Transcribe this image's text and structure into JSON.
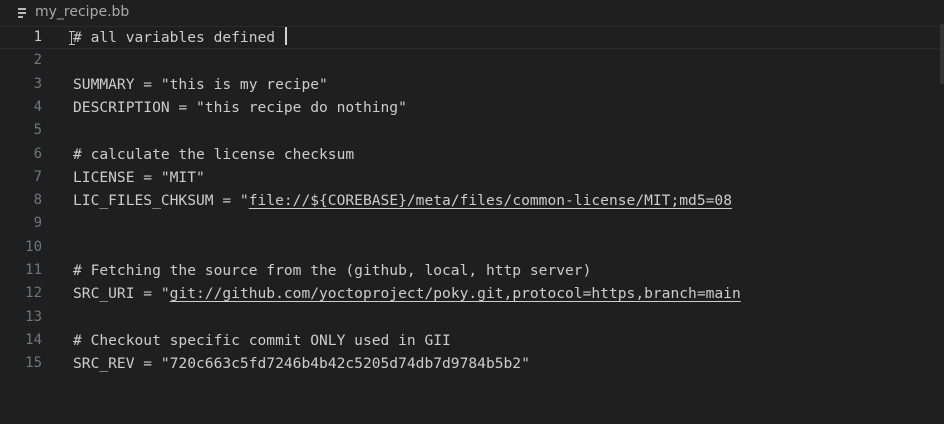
{
  "breadcrumb": {
    "icon": "file-lines-icon",
    "filename": "my_recipe.bb"
  },
  "editor": {
    "current_line": 1,
    "lines": [
      {
        "num": "1",
        "segments": [
          {
            "text": "# all variables defined ",
            "link": false
          }
        ]
      },
      {
        "num": "2",
        "segments": []
      },
      {
        "num": "3",
        "segments": [
          {
            "text": "SUMMARY = \"this is my recipe\"",
            "link": false
          }
        ]
      },
      {
        "num": "4",
        "segments": [
          {
            "text": "DESCRIPTION = \"this recipe do nothing\"",
            "link": false
          }
        ]
      },
      {
        "num": "5",
        "segments": []
      },
      {
        "num": "6",
        "segments": [
          {
            "text": "# calculate the license checksum",
            "link": false
          }
        ]
      },
      {
        "num": "7",
        "segments": [
          {
            "text": "LICENSE = \"MIT\"",
            "link": false
          }
        ]
      },
      {
        "num": "8",
        "segments": [
          {
            "text": "LIC_FILES_CHKSUM = \"",
            "link": false
          },
          {
            "text": "file://${COREBASE}/meta/files/common-license/MIT;md5=08",
            "link": true
          }
        ]
      },
      {
        "num": "9",
        "segments": []
      },
      {
        "num": "10",
        "segments": []
      },
      {
        "num": "11",
        "segments": [
          {
            "text": "# Fetching the source from the (github, local, http server)",
            "link": false
          }
        ]
      },
      {
        "num": "12",
        "segments": [
          {
            "text": "SRC_URI = \"",
            "link": false
          },
          {
            "text": "git://github.com/yoctoproject/poky.git,protocol=https,branch=main",
            "link": true
          }
        ]
      },
      {
        "num": "13",
        "segments": []
      },
      {
        "num": "14",
        "segments": [
          {
            "text": "# Checkout specific commit ONLY used in GII",
            "link": false
          }
        ]
      },
      {
        "num": "15",
        "segments": [
          {
            "text": "SRC_REV = \"720c663c5fd7246b4b42c5205d74db7d9784b5b2\"",
            "link": false
          }
        ]
      }
    ]
  }
}
